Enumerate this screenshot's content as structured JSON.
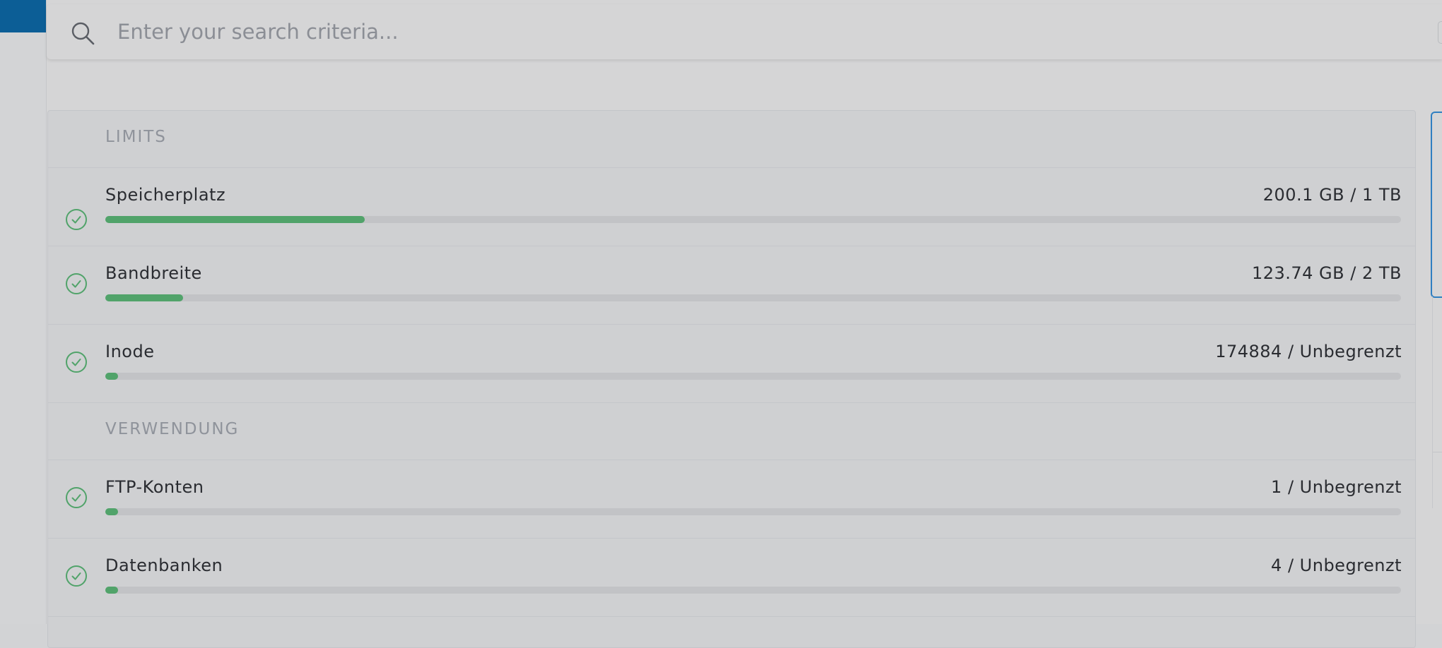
{
  "search": {
    "placeholder": "Enter your search criteria..."
  },
  "colors": {
    "accent_bar": "#0c5e96",
    "progress": "#51a36a",
    "check": "#51a36a"
  },
  "sections": [
    {
      "title": "LIMITS",
      "rows": [
        {
          "label": "Speicherplatz",
          "value": "200.1 GB / 1 TB",
          "fraction": 0.2,
          "icon": "check-circle-icon"
        },
        {
          "label": "Bandbreite",
          "value": "123.74 GB / 2 TB",
          "fraction": 0.06,
          "icon": "check-circle-icon"
        },
        {
          "label": "Inode",
          "value": "174884 / Unbegrenzt",
          "fraction": 0.01,
          "icon": "check-circle-icon"
        }
      ]
    },
    {
      "title": "VERWENDUNG",
      "rows": [
        {
          "label": "FTP-Konten",
          "value": "1 / Unbegrenzt",
          "fraction": 0.01,
          "icon": "check-circle-icon"
        },
        {
          "label": "Datenbanken",
          "value": "4 / Unbegrenzt",
          "fraction": 0.01,
          "icon": "check-circle-icon"
        }
      ]
    }
  ]
}
